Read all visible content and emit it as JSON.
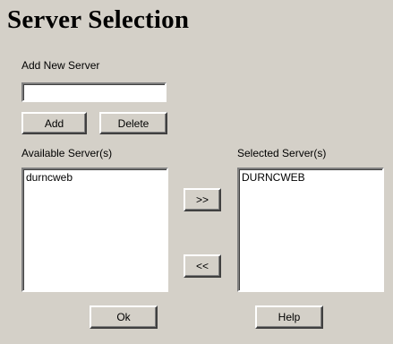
{
  "page": {
    "title": "Server Selection"
  },
  "add_server": {
    "label": "Add New Server",
    "input_value": "",
    "add_label": "Add",
    "delete_label": "Delete"
  },
  "available": {
    "label": "Available Server(s)",
    "items": [
      "durncweb"
    ]
  },
  "selected": {
    "label": "Selected Server(s)",
    "items": [
      "DURNCWEB"
    ]
  },
  "transfer": {
    "move_right_label": ">>",
    "move_left_label": "<<"
  },
  "footer": {
    "ok_label": "Ok",
    "help_label": "Help"
  }
}
